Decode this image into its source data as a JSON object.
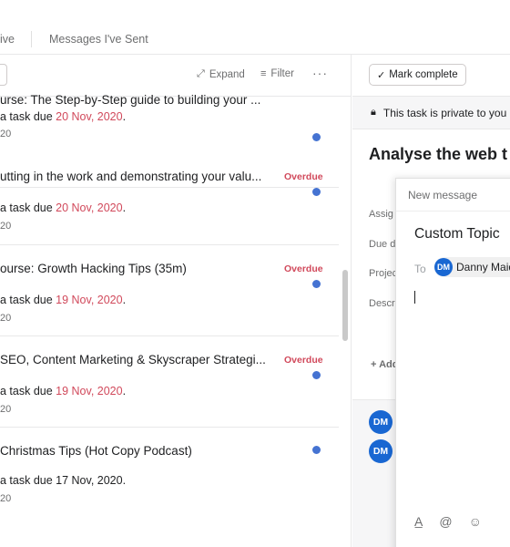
{
  "tabs": [
    {
      "label": "ive"
    },
    {
      "label": "Messages I've Sent"
    }
  ],
  "toolbar": {
    "expand_label": "Expand",
    "filter_label": "Filter",
    "more_label": "···"
  },
  "list": {
    "first_title": "urse: The Step-by-Step guide to building your ...",
    "items": [
      {
        "title": "",
        "prefix": "a task due ",
        "due": "20 Nov, 2020",
        "suffix": ".",
        "time": "20",
        "overdue": "",
        "due_overdue": true
      },
      {
        "title": "utting in the work and demonstrating your valu...",
        "prefix": "a task due ",
        "due": "20 Nov, 2020",
        "suffix": ".",
        "time": "20",
        "overdue": "Overdue",
        "due_overdue": true
      },
      {
        "title": "ourse: Growth Hacking Tips (35m)",
        "prefix": "a task due ",
        "due": "19 Nov, 2020",
        "suffix": ".",
        "time": "20",
        "overdue": "Overdue",
        "due_overdue": true
      },
      {
        "title": "SEO, Content Marketing & Skyscraper Strategi...",
        "prefix": "a task due ",
        "due": "19 Nov, 2020",
        "suffix": ".",
        "time": "20",
        "overdue": "Overdue",
        "due_overdue": true
      },
      {
        "title": "Christmas Tips (Hot Copy Podcast)",
        "prefix": "a task due ",
        "due": "17 Nov, 2020",
        "suffix": ".",
        "time": "20",
        "overdue": "",
        "due_overdue": false
      }
    ]
  },
  "task": {
    "mark_complete_label": "Mark complete",
    "private_notice": "This task is private to you",
    "title": "Analyse the web t month",
    "fields": [
      "Assig",
      "Due da",
      "Projec",
      "Descri"
    ],
    "add_subtask_label": "+ Add",
    "comment_avatars": [
      "DM",
      "DM"
    ]
  },
  "compose": {
    "header": "New message",
    "topic": "Custom Topic",
    "to_label": "To",
    "recipient_initials": "DM",
    "recipient_name": "Danny Maid"
  },
  "colors": {
    "accent_blue": "#4573d2",
    "avatar_blue": "#1967d2",
    "overdue_red": "#d1495b"
  }
}
